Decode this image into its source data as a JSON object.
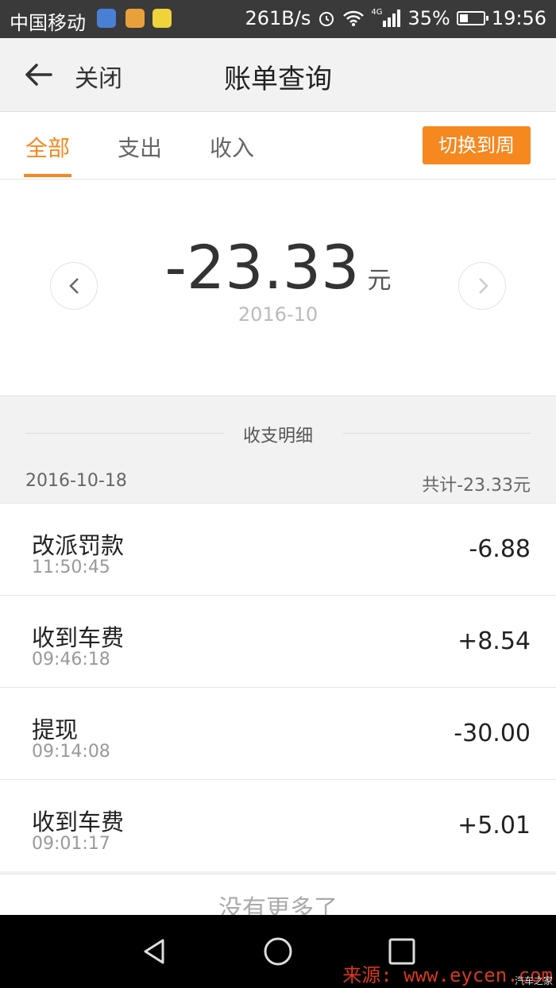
{
  "status_bar": {
    "carrier": "中国移动",
    "speed": "261B/s",
    "network": "4G",
    "battery": "35%",
    "battery_level": 0.35,
    "time": "19:56"
  },
  "header": {
    "close_label": "关闭",
    "title": "账单查询"
  },
  "tabs": [
    {
      "label": "全部",
      "active": true
    },
    {
      "label": "支出",
      "active": false
    },
    {
      "label": "收入",
      "active": false
    }
  ],
  "switch_button": "切换到周",
  "summary": {
    "amount": "-23.33",
    "unit": "元",
    "period": "2016-10"
  },
  "detail": {
    "section_label": "收支明细",
    "date": "2016-10-18",
    "day_total": "共计-23.33元"
  },
  "transactions": [
    {
      "title": "改派罚款",
      "time": "11:50:45",
      "amount": "-6.88"
    },
    {
      "title": "收到车费",
      "time": "09:46:18",
      "amount": "+8.54"
    },
    {
      "title": "提现",
      "time": "09:14:08",
      "amount": "-30.00"
    },
    {
      "title": "收到车费",
      "time": "09:01:17",
      "amount": "+5.01"
    }
  ],
  "no_more": "没有更多了",
  "watermark": "来源: www.eycen.com",
  "watermark_small": "汽车之家",
  "colors": {
    "accent": "#f5881f",
    "background": "#f2f2f2",
    "navbar": "#000000"
  }
}
